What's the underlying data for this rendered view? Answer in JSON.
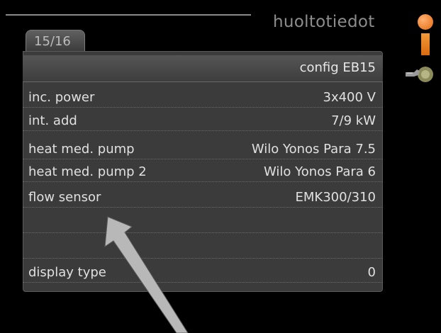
{
  "header": {
    "title": "huoltotiedot",
    "page_indicator": "15/16",
    "section": "config EB15"
  },
  "rows": [
    {
      "label": "inc. power",
      "value": "3x400 V"
    },
    {
      "label": "int. add",
      "value": "7/9 kW"
    },
    {
      "label": "heat med. pump",
      "value": "Wilo Yonos Para 7.5"
    },
    {
      "label": "heat med. pump 2",
      "value": "Wilo Yonos Para 6"
    },
    {
      "label": "flow sensor",
      "value": "EMK300/310"
    },
    {
      "label": "",
      "value": ""
    },
    {
      "label": "",
      "value": ""
    },
    {
      "label": "display type",
      "value": "0"
    }
  ],
  "icons": {
    "info": "info-icon",
    "tools": "wrench-icon",
    "annotation": "arrow-icon"
  },
  "colors": {
    "accent": "#e8761c",
    "panel": "#3b3b3b",
    "text": "#e0e0e0",
    "title": "#8d8d8d"
  }
}
